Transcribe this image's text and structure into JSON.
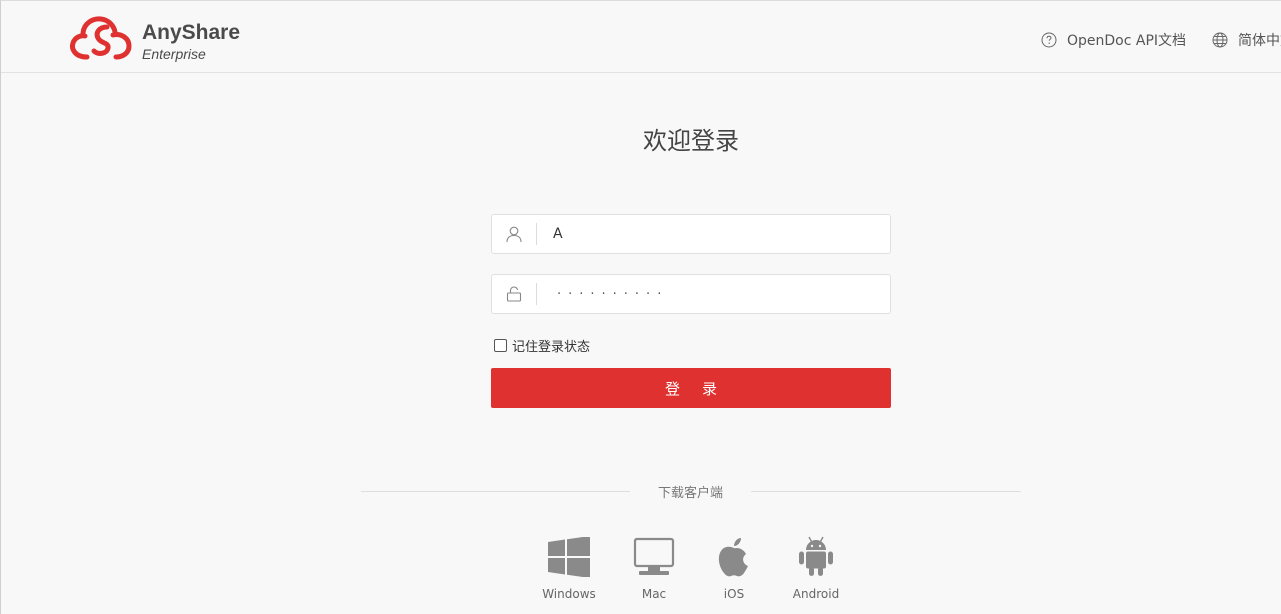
{
  "header": {
    "brand_title": "AnyShare",
    "brand_subtitle": "Enterprise",
    "brand_color": "#e03131",
    "api_doc_label": "OpenDoc API文档",
    "api_doc_icon": "question-circle-icon",
    "language_label": "简体中文",
    "language_icon": "globe-icon"
  },
  "login": {
    "title": "欢迎登录",
    "username_value": "A",
    "username_icon": "user-icon",
    "password_value": "··········",
    "password_icon": "lock-icon",
    "remember_label": "记住登录状态",
    "remember_checked": false,
    "submit_label": "登录",
    "submit_color": "#e03131"
  },
  "download": {
    "label": "下载客户端",
    "clients": [
      {
        "label": "Windows",
        "icon": "windows-icon"
      },
      {
        "label": "Mac",
        "icon": "mac-monitor-icon"
      },
      {
        "label": "iOS",
        "icon": "apple-icon"
      },
      {
        "label": "Android",
        "icon": "android-icon"
      }
    ]
  }
}
